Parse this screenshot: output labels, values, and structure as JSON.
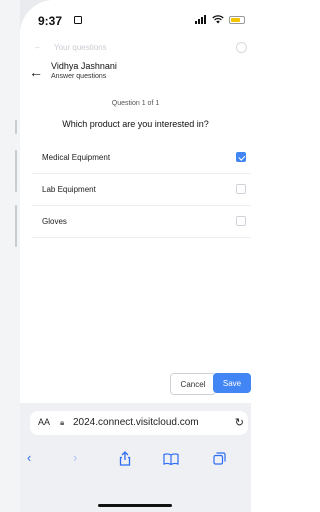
{
  "status_bar": {
    "time": "9:37"
  },
  "ghost_header": {
    "title": "Your questions"
  },
  "header": {
    "name": "Vidhya Jashnani",
    "subtitle": "Answer questions"
  },
  "question": {
    "counter": "Question 1 of 1",
    "title": "Which product are you interested in?"
  },
  "options": [
    {
      "label": "Medical Equipment",
      "checked": true
    },
    {
      "label": "Lab Equipment",
      "checked": false
    },
    {
      "label": "Gloves",
      "checked": false
    }
  ],
  "actions": {
    "cancel": "Cancel",
    "save": "Save"
  },
  "browser": {
    "aa_label": "AA",
    "url": "2024.connect.visitcloud.com"
  },
  "colors": {
    "accent": "#4285f4",
    "browser_blue": "#2f6df6"
  }
}
